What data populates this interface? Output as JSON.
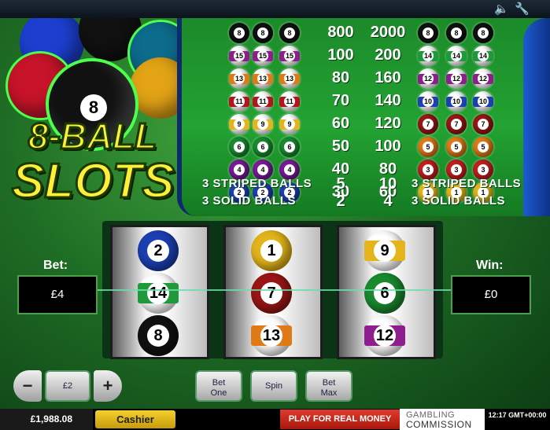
{
  "topbar": {
    "sound_icon": "speaker-icon",
    "settings_icon": "wrench-icon"
  },
  "logo": {
    "line1": "8-BALL",
    "line2": "SLOTS",
    "ball_number": "8"
  },
  "paytable": {
    "rows": [
      {
        "balls": [
          "8",
          "8",
          "8"
        ],
        "color": "#111111",
        "striped": false,
        "pay1": "800",
        "pay2": "2000",
        "right_balls": [
          "8",
          "8",
          "8"
        ]
      },
      {
        "balls": [
          "15",
          "15",
          "15"
        ],
        "color": "#8e1e8e",
        "striped": true,
        "pay1": "100",
        "pay2": "200",
        "right_balls": [
          "14",
          "14",
          "14"
        ],
        "right_color": "#1f9a3b",
        "right_striped": true
      },
      {
        "balls": [
          "13",
          "13",
          "13"
        ],
        "color": "#e07a16",
        "striped": true,
        "pay1": "80",
        "pay2": "160",
        "right_balls": [
          "12",
          "12",
          "12"
        ],
        "right_color": "#8e1e8e",
        "right_striped": true
      },
      {
        "balls": [
          "11",
          "11",
          "11"
        ],
        "color": "#b3151a",
        "striped": true,
        "pay1": "70",
        "pay2": "140",
        "right_balls": [
          "10",
          "10",
          "10"
        ],
        "right_color": "#1c3fb3",
        "right_striped": true
      },
      {
        "balls": [
          "9",
          "9",
          "9"
        ],
        "color": "#e3b51a",
        "striped": true,
        "pay1": "60",
        "pay2": "120",
        "right_balls": [
          "7",
          "7",
          "7"
        ],
        "right_color": "#9a1616",
        "right_striped": false
      },
      {
        "balls": [
          "6",
          "6",
          "6"
        ],
        "color": "#1a8a30",
        "striped": false,
        "pay1": "50",
        "pay2": "100",
        "right_balls": [
          "5",
          "5",
          "5"
        ],
        "right_color": "#e07a16",
        "right_striped": false
      },
      {
        "balls": [
          "4",
          "4",
          "4"
        ],
        "color": "#7a1a9a",
        "striped": false,
        "pay1": "40",
        "pay2": "80",
        "right_balls": [
          "3",
          "3",
          "3"
        ],
        "right_color": "#c41e1e",
        "right_striped": false
      },
      {
        "balls": [
          "2",
          "2",
          "2"
        ],
        "color": "#1c3fb3",
        "striped": false,
        "pay1": "30",
        "pay2": "60",
        "right_balls": [
          "1",
          "1",
          "1"
        ],
        "right_color": "#e3b51a",
        "right_striped": false
      }
    ],
    "any_rows": [
      {
        "label": "3 STRIPED BALLS",
        "pay1": "5",
        "pay2": "10",
        "right_label": "3 STRIPED BALLS"
      },
      {
        "label": "3 SOLID BALLS",
        "pay1": "2",
        "pay2": "4",
        "right_label": "3 SOLID BALLS"
      }
    ]
  },
  "reels": [
    [
      {
        "num": "2",
        "color": "#1c3fb3",
        "striped": false
      },
      {
        "num": "14",
        "color": "#1f9a3b",
        "striped": true
      },
      {
        "num": "8",
        "color": "#111111",
        "striped": false
      }
    ],
    [
      {
        "num": "1",
        "color": "#e3b51a",
        "striped": false
      },
      {
        "num": "7",
        "color": "#9a1616",
        "striped": false
      },
      {
        "num": "13",
        "color": "#e07a16",
        "striped": true
      }
    ],
    [
      {
        "num": "9",
        "color": "#e3b51a",
        "striped": true
      },
      {
        "num": "6",
        "color": "#1a8a30",
        "striped": false
      },
      {
        "num": "12",
        "color": "#8e1e8e",
        "striped": true
      }
    ]
  ],
  "bet": {
    "label": "Bet:",
    "value": "£4"
  },
  "win": {
    "label": "Win:",
    "value": "£0"
  },
  "controls": {
    "minus": "−",
    "coin_value": "£2",
    "plus": "+",
    "bet_one": "Bet One",
    "spin": "Spin",
    "bet_max": "Bet Max"
  },
  "footer": {
    "balance": "£1,988.08",
    "cashier": "Cashier",
    "real_money": "PLAY FOR REAL MONEY",
    "gc_line1": "GAMBLING",
    "gc_line2": "COMMISSION",
    "clock": "12:17 GMT+00:00"
  }
}
